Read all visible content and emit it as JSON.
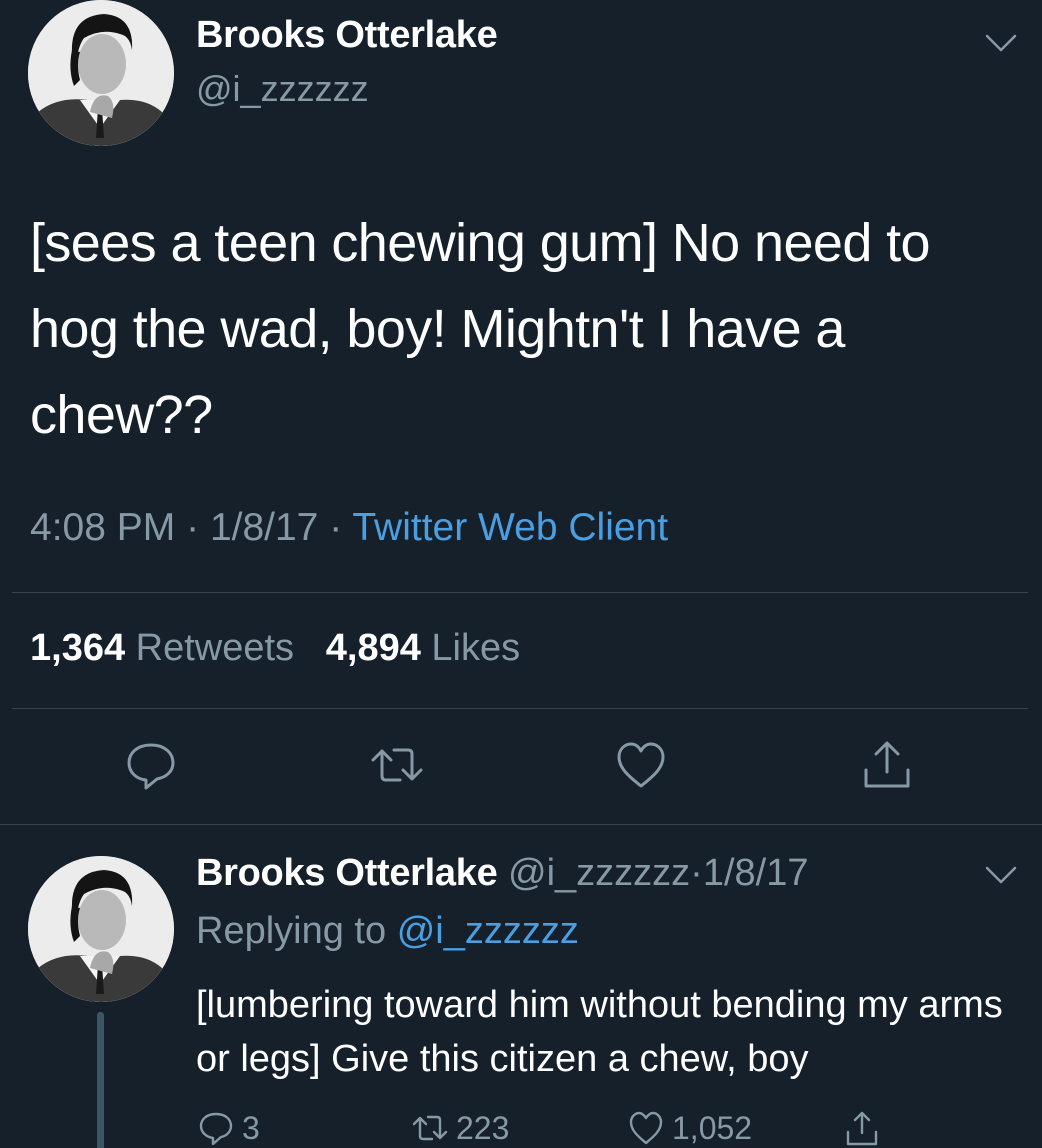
{
  "tweet": {
    "author_name": "Brooks Otterlake",
    "author_handle": "@i_zzzzzz",
    "text": "[sees a teen chewing gum] No need to hog the wad, boy! Mightn't I have a chew??",
    "time": "4:08 PM",
    "date": "1/8/17",
    "separator": "·",
    "client": "Twitter Web Client",
    "retweet_count": "1,364",
    "retweet_label": "Retweets",
    "like_count": "4,894",
    "like_label": "Likes",
    "actions": [
      "reply-icon",
      "retweet-icon",
      "like-icon",
      "share-icon"
    ]
  },
  "reply": {
    "author_name": "Brooks Otterlake",
    "author_handle": "@i_zzzzzz",
    "separator": "·",
    "date": "1/8/17",
    "replying_prefix": "Replying to",
    "replying_to": "@i_zzzzzz",
    "text": "[lumbering toward him without bending my arms or legs] Give this citizen a chew, boy",
    "reply_count": "3",
    "retweet_count": "223",
    "like_count": "1,052"
  },
  "colors": {
    "background": "#15202b",
    "secondary_text": "#8899a6",
    "link": "#4a9fe3",
    "divider": "#38444d"
  }
}
